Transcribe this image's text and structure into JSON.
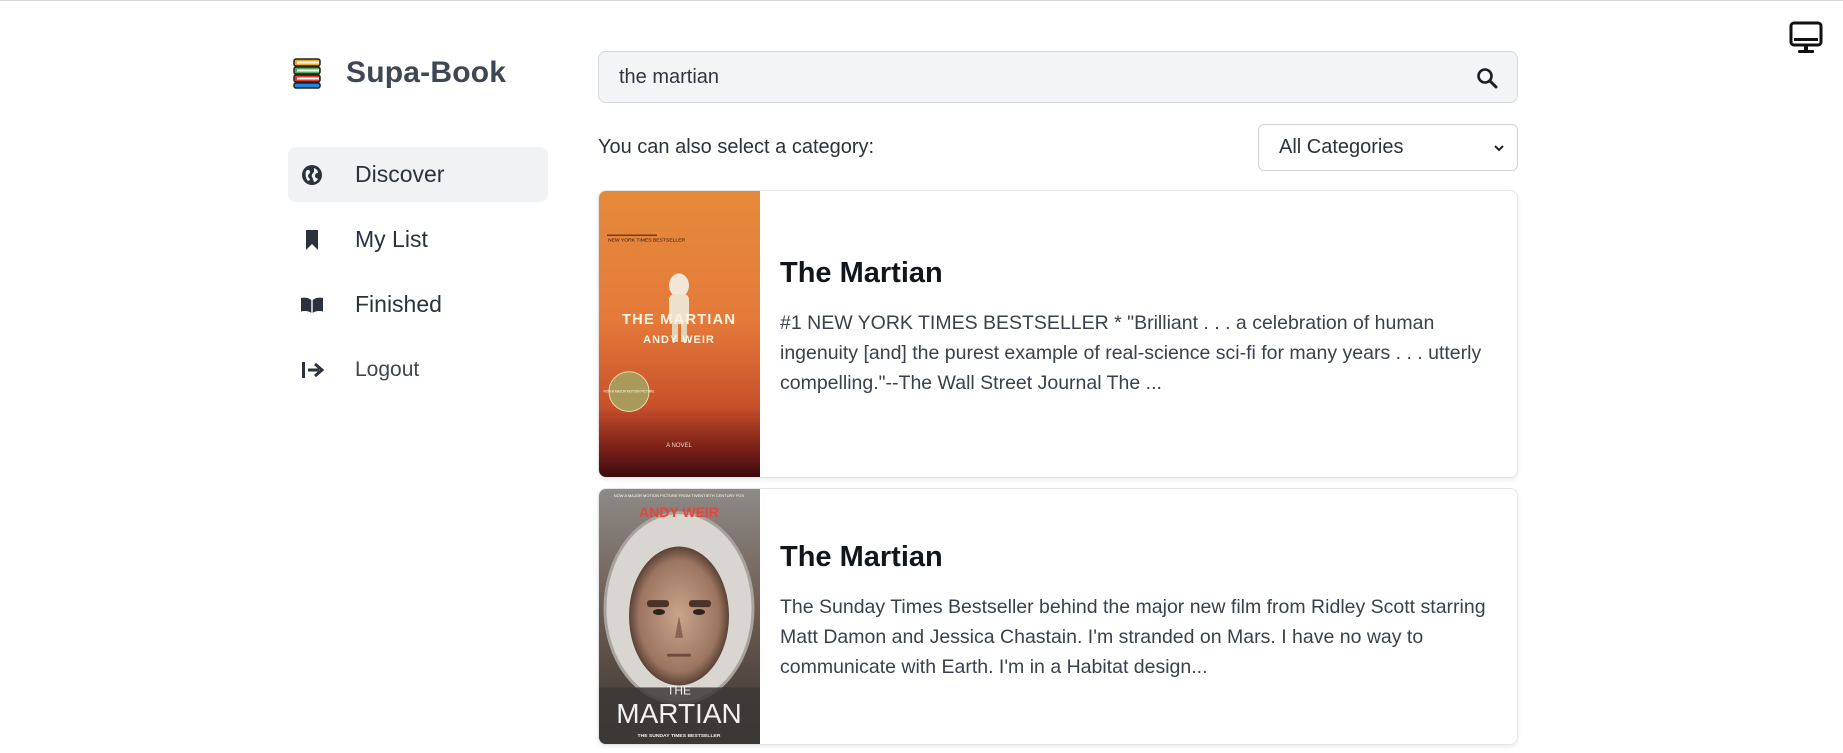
{
  "app": {
    "name": "Supa-Book"
  },
  "sidebar": {
    "items": [
      {
        "label": "Discover",
        "icon": "globe-icon",
        "active": true
      },
      {
        "label": "My List",
        "icon": "bookmark-icon",
        "active": false
      },
      {
        "label": "Finished",
        "icon": "open-book-icon",
        "active": false
      },
      {
        "label": "Logout",
        "icon": "logout-icon",
        "active": false
      }
    ]
  },
  "search": {
    "value": "the martian",
    "placeholder": ""
  },
  "category": {
    "label": "You can also select a category:",
    "selected": "All Categories"
  },
  "results": [
    {
      "title": "The Martian",
      "description": "#1 NEW YORK TIMES BESTSELLER * \"Brilliant . . . a celebration of human ingenuity [and] the purest example of real-science sci-fi for many years . . . utterly compelling.\"--The Wall Street Journal The ...",
      "cover": {
        "title": "THE MARTIAN",
        "author": "ANDY WEIR",
        "badge": "NEW YORK TIMES BESTSELLER",
        "seal": "NOW A MAJOR MOTION PICTURE",
        "footer": "A NOVEL"
      }
    },
    {
      "title": "The Martian",
      "description": "The Sunday Times Bestseller behind the major new film from Ridley Scott starring Matt Damon and Jessica Chastain. I'm stranded on Mars. I have no way to communicate with Earth. I'm in a Habitat design...",
      "cover": {
        "title_top": "THE",
        "title": "MARTIAN",
        "author": "ANDY WEIR",
        "badge": "NOW A MAJOR MOTION PICTURE FROM TWENTIETH CENTURY FOX",
        "footer": "THE SUNDAY TIMES BESTSELLER"
      }
    }
  ],
  "colors": {
    "active_bg": "#f1f2f4",
    "text": "#1f2937",
    "border": "#e3e5e8"
  }
}
